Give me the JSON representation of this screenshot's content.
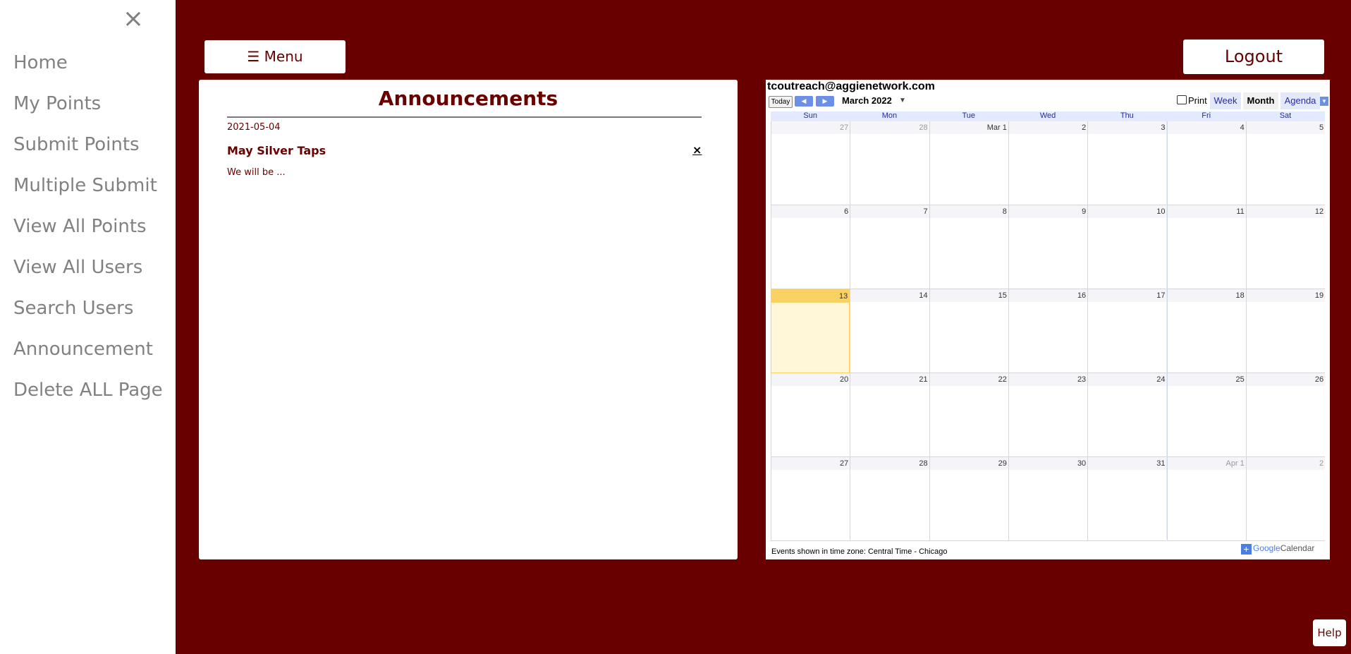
{
  "sidebar": {
    "close_glyph": "×",
    "items": [
      {
        "label": "Home"
      },
      {
        "label": "My Points"
      },
      {
        "label": "Submit Points"
      },
      {
        "label": "Multiple Submit"
      },
      {
        "label": "View All Points"
      },
      {
        "label": "View All Users"
      },
      {
        "label": "Search Users"
      },
      {
        "label": "Announcement"
      },
      {
        "label": "Delete ALL Page"
      }
    ]
  },
  "header": {
    "menu_label": "☰ Menu",
    "logout_label": "Logout"
  },
  "announcements": {
    "title": "Announcements",
    "items": [
      {
        "date": "2021-05-04",
        "title": "May Silver Taps",
        "body": "We will be ...",
        "delete_glyph": "×"
      }
    ]
  },
  "calendar": {
    "owner": "tcoutreach@aggienetwork.com",
    "today_label": "Today",
    "month_label": "March 2022",
    "print_label": "Print",
    "tabs": [
      "Week",
      "Month",
      "Agenda"
    ],
    "active_tab": "Month",
    "weekdays": [
      "Sun",
      "Mon",
      "Tue",
      "Wed",
      "Thu",
      "Fri",
      "Sat"
    ],
    "weeks": [
      [
        "27",
        "28",
        "Mar 1",
        "2",
        "3",
        "4",
        "5"
      ],
      [
        "6",
        "7",
        "8",
        "9",
        "10",
        "11",
        "12"
      ],
      [
        "13",
        "14",
        "15",
        "16",
        "17",
        "18",
        "19"
      ],
      [
        "20",
        "21",
        "22",
        "23",
        "24",
        "25",
        "26"
      ],
      [
        "27",
        "28",
        "29",
        "30",
        "31",
        "Apr 1",
        "2"
      ]
    ],
    "today_date": "13",
    "timezone_note": "Events shown in time zone: Central Time - Chicago",
    "brand": {
      "google": "Google",
      "calendar": "Calendar"
    },
    "colors": {
      "today_band": "#fad163",
      "today_fill": "#fff7d7",
      "nav_blue": "#6d8fe6"
    }
  },
  "help_label": "Help",
  "colors": {
    "brand": "#680000",
    "sidebar_text": "#818181"
  }
}
